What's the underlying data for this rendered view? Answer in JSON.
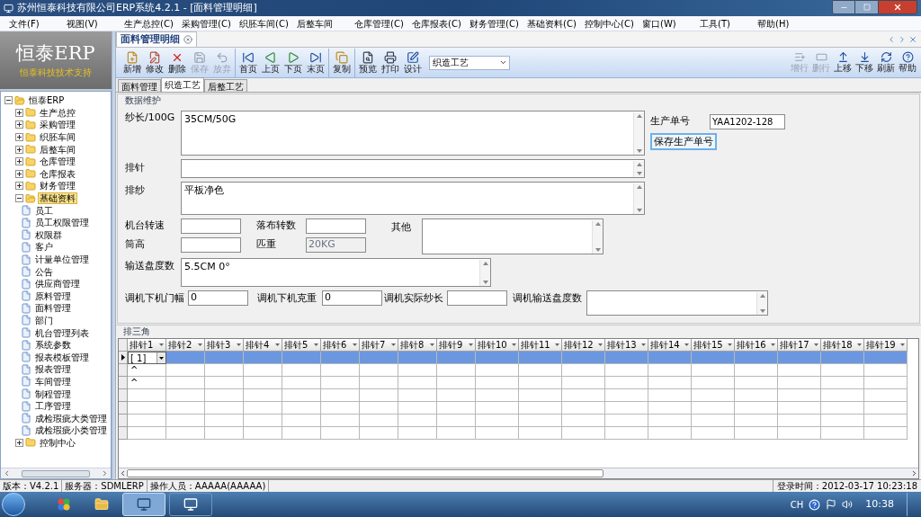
{
  "window": {
    "title": "苏州恒泰科技有限公司ERP系统4.2.1 - [面料管理明细]"
  },
  "menu": [
    "文件(F)",
    "视图(V)",
    "生产总控(C)",
    "采购管理(C)",
    "织胚车间(C)",
    "后整车间",
    "仓库管理(C)",
    "仓库报表(C)",
    "财务管理(C)",
    "基础资料(C)",
    "控制中心(C)",
    "窗口(W)",
    "工具(T)",
    "帮助(H)"
  ],
  "logo": {
    "title": "恒泰ERP",
    "subtitle": "恒泰科技技术支持"
  },
  "tree": {
    "label": "恒泰ERP",
    "kind": "folder",
    "expanded": true,
    "selected": false,
    "children": [
      {
        "label": "生产总控",
        "kind": "folder",
        "expanded": false,
        "selected": false
      },
      {
        "label": "采购管理",
        "kind": "folder",
        "expanded": false,
        "selected": false
      },
      {
        "label": "织胚车间",
        "kind": "folder",
        "expanded": false,
        "selected": false
      },
      {
        "label": "后整车间",
        "kind": "folder",
        "expanded": false,
        "selected": false
      },
      {
        "label": "仓库管理",
        "kind": "folder",
        "expanded": false,
        "selected": false
      },
      {
        "label": "仓库报表",
        "kind": "folder",
        "expanded": false,
        "selected": false
      },
      {
        "label": "财务管理",
        "kind": "folder",
        "expanded": false,
        "selected": false
      },
      {
        "label": "基础资料",
        "kind": "folder",
        "expanded": true,
        "selected": true,
        "children": [
          {
            "label": "员工",
            "kind": "page",
            "selected": false
          },
          {
            "label": "员工权限管理",
            "kind": "page",
            "selected": false
          },
          {
            "label": "权限群",
            "kind": "page",
            "selected": false
          },
          {
            "label": "客户",
            "kind": "page",
            "selected": false
          },
          {
            "label": "计量单位管理",
            "kind": "page",
            "selected": false
          },
          {
            "label": "公告",
            "kind": "page",
            "selected": false
          },
          {
            "label": "供应商管理",
            "kind": "page",
            "selected": false
          },
          {
            "label": "原料管理",
            "kind": "page",
            "selected": false
          },
          {
            "label": "面料管理",
            "kind": "page",
            "selected": false
          },
          {
            "label": "部门",
            "kind": "page",
            "selected": false
          },
          {
            "label": "机台管理列表",
            "kind": "page",
            "selected": false
          },
          {
            "label": "系统参数",
            "kind": "page",
            "selected": false
          },
          {
            "label": "报表模板管理",
            "kind": "page",
            "selected": false
          },
          {
            "label": "报表管理",
            "kind": "page",
            "selected": false
          },
          {
            "label": "车间管理",
            "kind": "page",
            "selected": false
          },
          {
            "label": "制程管理",
            "kind": "page",
            "selected": false
          },
          {
            "label": "工序管理",
            "kind": "page",
            "selected": false
          },
          {
            "label": "成检瑕疵大类管理",
            "kind": "page",
            "selected": false
          },
          {
            "label": "成检瑕疵小类管理",
            "kind": "page",
            "selected": false
          }
        ]
      },
      {
        "label": "控制中心",
        "kind": "folder",
        "expanded": false,
        "selected": false
      }
    ]
  },
  "doc_tabs": [
    {
      "label": "面料管理明细",
      "selected": true
    }
  ],
  "toolbar": {
    "groups": [
      [
        {
          "label": "新增",
          "disabled": false
        },
        {
          "label": "修改",
          "disabled": false
        },
        {
          "label": "删除",
          "disabled": false
        },
        {
          "label": "保存",
          "disabled": true
        },
        {
          "label": "放弃",
          "disabled": true
        }
      ],
      [
        {
          "label": "首页",
          "disabled": false
        },
        {
          "label": "上页",
          "disabled": false
        },
        {
          "label": "下页",
          "disabled": false
        },
        {
          "label": "末页",
          "disabled": false
        }
      ],
      [
        {
          "label": "复制",
          "disabled": false
        }
      ],
      [
        {
          "label": "预览",
          "disabled": false
        },
        {
          "label": "打印",
          "disabled": false
        },
        {
          "label": "设计",
          "disabled": false
        }
      ]
    ],
    "select": {
      "value": "织造工艺"
    },
    "right_buttons": [
      {
        "label": "增行",
        "disabled": true
      },
      {
        "label": "删行",
        "disabled": true
      },
      {
        "label": "上移",
        "disabled": false
      },
      {
        "label": "下移",
        "disabled": false
      },
      {
        "label": "刷新",
        "disabled": false
      },
      {
        "label": "帮助",
        "disabled": false
      }
    ]
  },
  "sub_tabs": [
    {
      "label": "面料管理",
      "selected": false
    },
    {
      "label": "织造工艺",
      "selected": true
    },
    {
      "label": "后整工艺",
      "selected": false
    }
  ],
  "form": {
    "title": "数据维护",
    "fields": [
      {
        "label": "纱长/100G",
        "kind": "textarea",
        "value": "35CM/50G",
        "disabled": false
      },
      {
        "label": "排针",
        "kind": "textarea",
        "disabled": false
      },
      {
        "label": "排纱",
        "kind": "textarea",
        "value": "平板净色",
        "disabled": false
      },
      {
        "label": "机台转速",
        "kind": "input",
        "disabled": false
      },
      {
        "label": "落布转数",
        "kind": "input",
        "disabled": false
      },
      {
        "label": "其他",
        "kind": "textarea",
        "disabled": false
      },
      {
        "label": "筒高",
        "kind": "input",
        "disabled": false
      },
      {
        "label": "匹重",
        "kind": "input",
        "value": "20KG",
        "disabled": true
      },
      {
        "label": "输送盘度数",
        "kind": "textarea",
        "value": "5.5CM 0°",
        "disabled": false
      },
      {
        "label": "调机下机门幅",
        "kind": "input",
        "value": "0",
        "disabled": false
      },
      {
        "label": "调机下机克重",
        "kind": "input",
        "value": "0",
        "disabled": false
      },
      {
        "label": "调机实际纱长",
        "kind": "input",
        "disabled": false
      },
      {
        "label": "调机输送盘度数",
        "kind": "textarea",
        "disabled": false
      }
    ],
    "order_no": {
      "label": "生产单号",
      "value": "YAA1202-128"
    },
    "save_button": "保存生产单号"
  },
  "grid": {
    "title": "排三角",
    "columns": [
      "排针1",
      "排针2",
      "排针3",
      "排针4",
      "排针5",
      "排针6",
      "排针7",
      "排针8",
      "排针9",
      "排针10",
      "排针11",
      "排针12",
      "排针13",
      "排针14",
      "排针15",
      "排针16",
      "排针17",
      "排针18",
      "排针19"
    ],
    "rows": [
      {
        "selected": true,
        "cells": [
          "[ 1]"
        ]
      },
      {
        "selected": false,
        "cells": [
          "^"
        ]
      },
      {
        "selected": false,
        "cells": [
          "^"
        ]
      },
      {
        "selected": false,
        "cells": []
      },
      {
        "selected": false,
        "cells": []
      },
      {
        "selected": false,
        "cells": []
      },
      {
        "selected": false,
        "cells": []
      }
    ]
  },
  "status_bar": [
    "版本：V4.2.1",
    "服务器：SDMLERP",
    "操作人员：AAAAA(AAAAA)"
  ],
  "login_time": "登录时间：2012-03-17 10:23:18",
  "taskbar": {
    "ime": "CH",
    "clock": "10:38"
  }
}
